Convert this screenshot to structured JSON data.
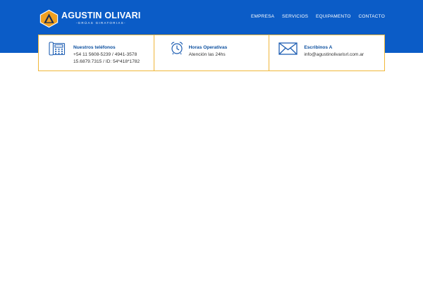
{
  "colors": {
    "header_blue": "#0b5cc7",
    "accent_orange": "#f0a020",
    "border_gold": "#f0b73a",
    "title_blue": "#0b4f9f",
    "icon_blue": "#1f5fb3"
  },
  "logo": {
    "name": "AGUSTIN OLIVARI",
    "tagline": "-GRÚAS GIRATORIAS-",
    "icon": "triangle-logo-icon"
  },
  "nav": {
    "items": [
      {
        "label": "EMPRESA"
      },
      {
        "label": "SERVICIOS"
      },
      {
        "label": "EQUIPAMENTO"
      },
      {
        "label": "CONTACTO"
      }
    ]
  },
  "info": {
    "phones": {
      "icon": "phone-icon",
      "title": "Nuestros teléfonos",
      "line1": "+54 11 5608-5239 / 4941-3578",
      "line2": "15.6879.7315 / ID: 54*418*1782"
    },
    "hours": {
      "icon": "alarm-clock-icon",
      "title": "Horas Operativas",
      "line1": "Atención las 24hs"
    },
    "email": {
      "icon": "envelope-icon",
      "title": "Escribinos A",
      "line1": "info@agustinolivarisrl.com.ar"
    }
  }
}
